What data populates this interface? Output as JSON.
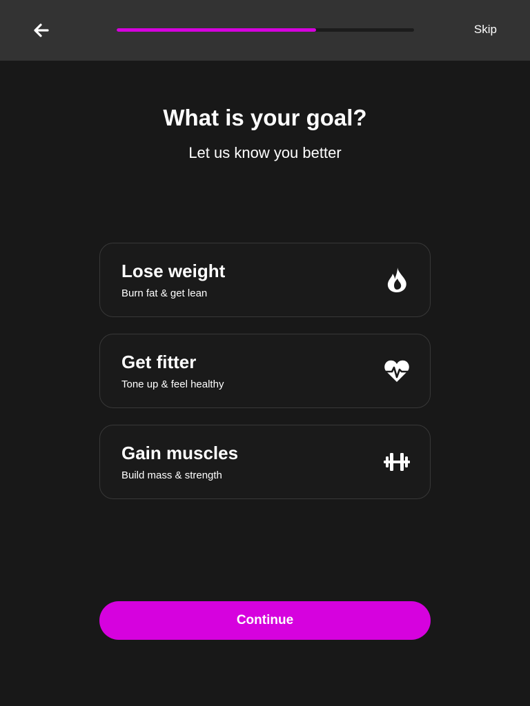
{
  "header": {
    "back_icon": "arrow-left-icon",
    "progress_fraction": 0.67,
    "skip_label": "Skip"
  },
  "main": {
    "title": "What is your goal?",
    "subtitle": "Let us know you better"
  },
  "options": [
    {
      "title": "Lose weight",
      "subtitle": "Burn fat & get lean",
      "icon": "flame-icon"
    },
    {
      "title": "Get fitter",
      "subtitle": "Tone up & feel healthy",
      "icon": "heartbeat-icon"
    },
    {
      "title": "Gain muscles",
      "subtitle": "Build mass & strength",
      "icon": "dumbbell-icon"
    }
  ],
  "footer": {
    "continue_label": "Continue"
  },
  "colors": {
    "accent": "#d602de",
    "background": "#181818",
    "header_background": "#333333",
    "card_border": "#383838"
  }
}
